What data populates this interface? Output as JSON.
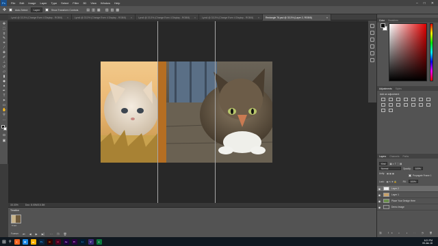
{
  "menubar": {
    "logo": "Ps",
    "items": [
      "File",
      "Edit",
      "Image",
      "Layer",
      "Type",
      "Select",
      "Filter",
      "3D",
      "View",
      "Window",
      "Help"
    ],
    "window_controls": [
      "–",
      "□",
      "✕"
    ]
  },
  "options": {
    "auto_select_label": "Auto-Select:",
    "auto_select_value": "Layer",
    "transform_label": "Show Transform Controls"
  },
  "tabs": [
    {
      "label": "Lyra4 @ 33.3% (Change Even 4 Display - RGB/8)",
      "active": false
    },
    {
      "label": "Lyra4 @ 33.3% (Change Even 4 Display - RGB/8)",
      "active": false
    },
    {
      "label": "Lyra4 @ 33.3% (Change Even 4 Display - RGB/8)",
      "active": false
    },
    {
      "label": "Lyra4 @ 33.3% (Change Even 4 Display - RGB/8)",
      "active": false
    },
    {
      "label": "Rectangle 76.psd @ 33.3% (Layer 2, RGB/8)",
      "active": true
    }
  ],
  "status": {
    "zoom": "33.33%",
    "doc": "Doc: 8.00M/15.3M"
  },
  "timeline": {
    "title": "Timeline",
    "frame_time": "0 sec.",
    "loop": "Forever"
  },
  "panels": {
    "color_tabs": [
      "Color",
      "Swatches"
    ],
    "adjust_tabs": [
      "Adjustments",
      "Styles"
    ],
    "adjust_label": "Add an adjustment",
    "layers_tabs": [
      "Layers",
      "Channels",
      "Paths"
    ],
    "kind": "Kind",
    "blend": "Normal",
    "opacity_label": "Opacity:",
    "opacity_value": "100%",
    "unify_label": "Unify:",
    "propagate_label": "Propagate Frame 1",
    "lock_label": "Lock:",
    "fill_label": "Fill:",
    "fill_value": "100%",
    "layers": [
      {
        "name": "Layer 2",
        "selected": true
      },
      {
        "name": "Layer 1",
        "selected": false
      },
      {
        "name": "Place Your Design Here",
        "selected": false
      },
      {
        "name": "Demo Image",
        "selected": false
      }
    ]
  },
  "taskbar": {
    "apps": [
      "Ps",
      "Ai",
      "Id",
      "Ae",
      "Pr",
      "Lr",
      "V"
    ],
    "time": "6:21 PM",
    "date": "05-Jan-16"
  }
}
